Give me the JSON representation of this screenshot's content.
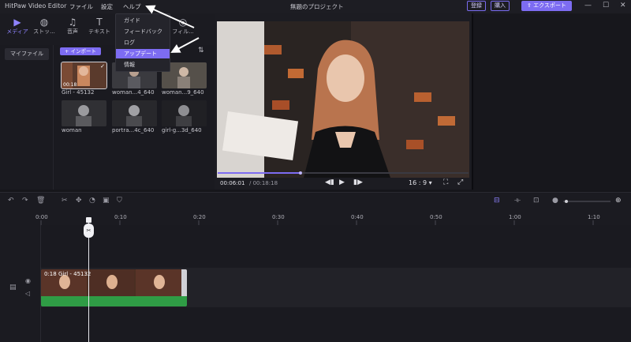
{
  "titlebar": {
    "app_title": "HitPaw Video Editor",
    "menus": [
      "ファイル",
      "設定",
      "ヘルプ"
    ],
    "project_title": "無題のプロジェクト",
    "register": "登録",
    "purchase": "購入",
    "export": "エクスポート",
    "minimize_icon": "—",
    "maximize_icon": "☐",
    "close_icon": "✕"
  },
  "tools": [
    {
      "label": "メディア",
      "icon": "media-icon",
      "glyph": "▶"
    },
    {
      "label": "ストッ...",
      "icon": "globe-icon",
      "glyph": "◍"
    },
    {
      "label": "音声",
      "icon": "music-icon",
      "glyph": "♫"
    },
    {
      "label": "テキスト",
      "icon": "text-icon",
      "glyph": "T"
    },
    {
      "label": "フィル...",
      "icon": "filter-icon",
      "glyph": "◎"
    }
  ],
  "help_menu": {
    "items": [
      "ガイド",
      "フィードバック",
      "ログ",
      "アップデート",
      "情報"
    ],
    "highlighted": "アップデート"
  },
  "leftnav": {
    "my_files": "マイファイル"
  },
  "media": {
    "import_label": "+ インポート",
    "items": [
      {
        "name": "Girl - 45132",
        "duration": "00:18",
        "selected": true
      },
      {
        "name": "woman...4_640",
        "duration": "",
        "selected": false
      },
      {
        "name": "woman...9_640",
        "duration": "",
        "selected": false
      },
      {
        "name": "woman",
        "duration": "",
        "selected": false
      },
      {
        "name": "portra...4c_640",
        "duration": "",
        "selected": false
      },
      {
        "name": "girl-g...3d_640",
        "duration": "",
        "selected": false
      }
    ]
  },
  "preview": {
    "current_time": "00:06:01",
    "total_time": "/ 00:18:18",
    "progress": 0.33,
    "aspect_ratio": "16 : 9",
    "ratio_caret": "▾"
  },
  "timeline": {
    "ruler_labels": [
      "0:00",
      "0:10",
      "0:20",
      "0:30",
      "0:40",
      "0:50",
      "1:00",
      "1:10"
    ],
    "clip_label": "0:18  Girl - 45132",
    "playhead_time": "0:06"
  },
  "colors": {
    "accent": "#7d6cf2",
    "clip_green": "#2f9c45"
  }
}
